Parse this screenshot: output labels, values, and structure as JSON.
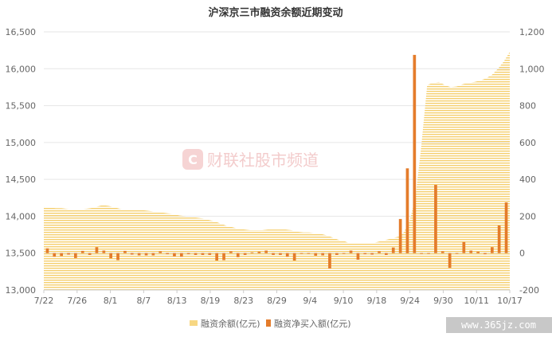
{
  "chart_data": {
    "type": "bar+area",
    "title": "沪深京三市融资余额近期变动",
    "x_tick_labels": [
      "7/22",
      "7/26",
      "8/1",
      "8/7",
      "8/13",
      "8/19",
      "8/23",
      "8/29",
      "9/4",
      "9/10",
      "9/18",
      "9/24",
      "9/30",
      "10/11",
      "10/17"
    ],
    "left_axis": {
      "ticks": [
        13000,
        13500,
        14000,
        14500,
        15000,
        15500,
        16000,
        16500
      ],
      "ylim": [
        13000,
        16500
      ]
    },
    "right_axis": {
      "ticks": [
        -200,
        0,
        200,
        400,
        600,
        800,
        1000,
        1200
      ],
      "ylim": [
        -200,
        1200
      ]
    },
    "series": [
      {
        "name": "融资余额(亿元)",
        "type": "area",
        "axis": "left",
        "color": "#f7d783",
        "values": [
          14130,
          14120,
          14110,
          14110,
          14100,
          14090,
          14090,
          14100,
          14110,
          14130,
          14150,
          14140,
          14120,
          14100,
          14090,
          14080,
          14080,
          14080,
          14070,
          14060,
          14050,
          14040,
          14030,
          14010,
          14000,
          13990,
          13980,
          13970,
          13950,
          13930,
          13900,
          13870,
          13850,
          13830,
          13820,
          13810,
          13810,
          13810,
          13820,
          13820,
          13820,
          13820,
          13810,
          13790,
          13780,
          13780,
          13770,
          13760,
          13740,
          13710,
          13680,
          13660,
          13630,
          13630,
          13630,
          13630,
          13640,
          13660,
          13680,
          13700,
          13720,
          13780,
          13930,
          14250,
          14950,
          15780,
          15810,
          15820,
          15780,
          15750,
          15760,
          15790,
          15810,
          15820,
          15840,
          15870,
          15920,
          16000,
          16100,
          16230
        ]
      },
      {
        "name": "融资净买入额(亿元)",
        "type": "bar",
        "axis": "right",
        "color": "#e47c2b",
        "values": [
          26,
          -20,
          -16,
          -8,
          -27,
          12,
          -10,
          32,
          14,
          -28,
          -38,
          12,
          -8,
          -12,
          -12,
          -12,
          10,
          -6,
          -18,
          -20,
          -6,
          -10,
          -10,
          -10,
          -40,
          -38,
          10,
          -22,
          -10,
          4,
          8,
          14,
          -10,
          -10,
          -20,
          -40,
          -4,
          -4,
          -14,
          -12,
          -84,
          -10,
          -4,
          14,
          -36,
          -6,
          -8,
          10,
          -10,
          30,
          185,
          460,
          1075,
          -4,
          -4,
          370,
          10,
          -80,
          -4,
          60,
          14,
          8,
          -6,
          32,
          150,
          275
        ]
      }
    ],
    "legend_position": "bottom-center",
    "grid": true
  },
  "watermark": {
    "text": "财联社股市频道",
    "icon_letter": "C"
  },
  "site_label": "www.365jz.com"
}
